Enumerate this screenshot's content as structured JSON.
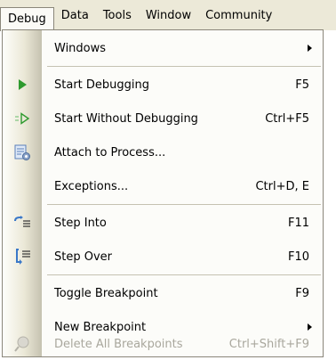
{
  "menubar": {
    "items": [
      "Debug",
      "Data",
      "Tools",
      "Window",
      "Community"
    ]
  },
  "menu": {
    "items": [
      {
        "label": "Windows",
        "shortcut": "",
        "submenu": true,
        "icon": "none",
        "enabled": true
      },
      {
        "label": "Start Debugging",
        "shortcut": "F5",
        "submenu": false,
        "icon": "play-icon",
        "enabled": true
      },
      {
        "label": "Start Without Debugging",
        "shortcut": "Ctrl+F5",
        "submenu": false,
        "icon": "play-outline-icon",
        "enabled": true
      },
      {
        "label": "Attach to Process...",
        "shortcut": "",
        "submenu": false,
        "icon": "attach-process-icon",
        "enabled": true
      },
      {
        "label": "Exceptions...",
        "shortcut": "Ctrl+D, E",
        "submenu": false,
        "icon": "none",
        "enabled": true
      },
      {
        "label": "Step Into",
        "shortcut": "F11",
        "submenu": false,
        "icon": "step-into-icon",
        "enabled": true
      },
      {
        "label": "Step Over",
        "shortcut": "F10",
        "submenu": false,
        "icon": "step-over-icon",
        "enabled": true
      },
      {
        "label": "Toggle Breakpoint",
        "shortcut": "F9",
        "submenu": false,
        "icon": "none",
        "enabled": true
      },
      {
        "label": "New Breakpoint",
        "shortcut": "",
        "submenu": true,
        "icon": "none",
        "enabled": true
      },
      {
        "label": "Delete All Breakpoints",
        "shortcut": "Ctrl+Shift+F9",
        "submenu": false,
        "icon": "delete-breakpoints-icon",
        "enabled": false
      }
    ]
  },
  "colors": {
    "menubar_bg": "#ece9d8",
    "menu_bg": "#fcfcf9",
    "disabled_text": "#a9a79d",
    "play_green": "#2e9a2e"
  }
}
